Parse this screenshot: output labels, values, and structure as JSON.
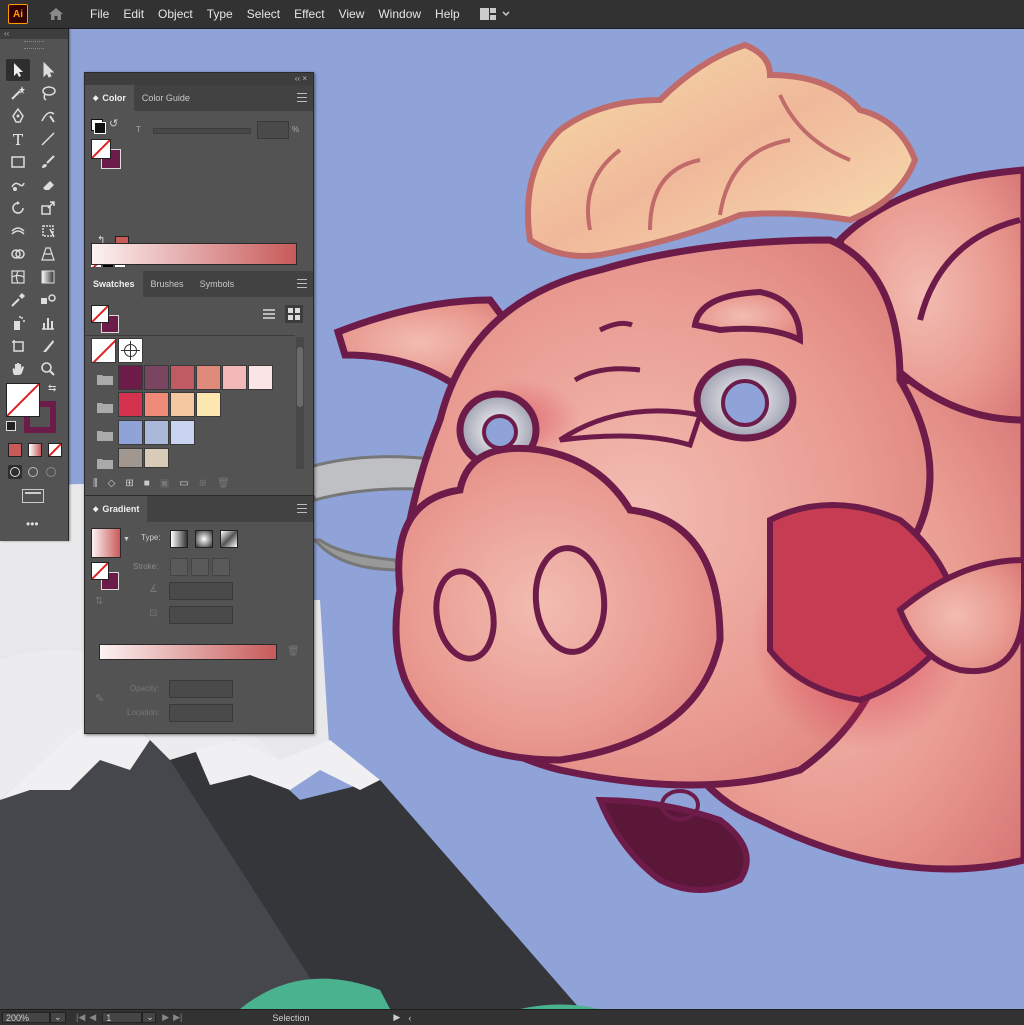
{
  "app": {
    "logo": "Ai"
  },
  "menu": [
    "File",
    "Edit",
    "Object",
    "Type",
    "Select",
    "Effect",
    "View",
    "Window",
    "Help"
  ],
  "panel_color": {
    "tabs": [
      "Color",
      "Color Guide"
    ],
    "tint_label": "T",
    "percent": "%",
    "colors": {
      "fill": "#ffffff",
      "stroke": "#6d1c4a",
      "out_of_gamut": "#c85a5a"
    }
  },
  "panel_swatches": {
    "tabs": [
      "Swatches",
      "Brushes",
      "Symbols"
    ],
    "groups": [
      [
        "#6d1c4a",
        "#7a4560",
        "#c05b64",
        "#e08a7c",
        "#f4b8b8",
        "#fbe4e6"
      ],
      [
        "#d4324f",
        "#ef8a78",
        "#f4c8a0",
        "#fde7b0"
      ],
      [
        "#8fa3d8",
        "#aab8d9",
        "#c9d5f0"
      ],
      [
        "#a09890",
        "#d8cbb8"
      ]
    ]
  },
  "panel_gradient": {
    "tab": "Gradient",
    "type_label": "Type:",
    "stroke_label": "Stroke:",
    "opacity_label": "Opacity:",
    "location_label": "Location:"
  },
  "status": {
    "zoom": "200%",
    "artboard": "1",
    "tool": "Selection"
  }
}
